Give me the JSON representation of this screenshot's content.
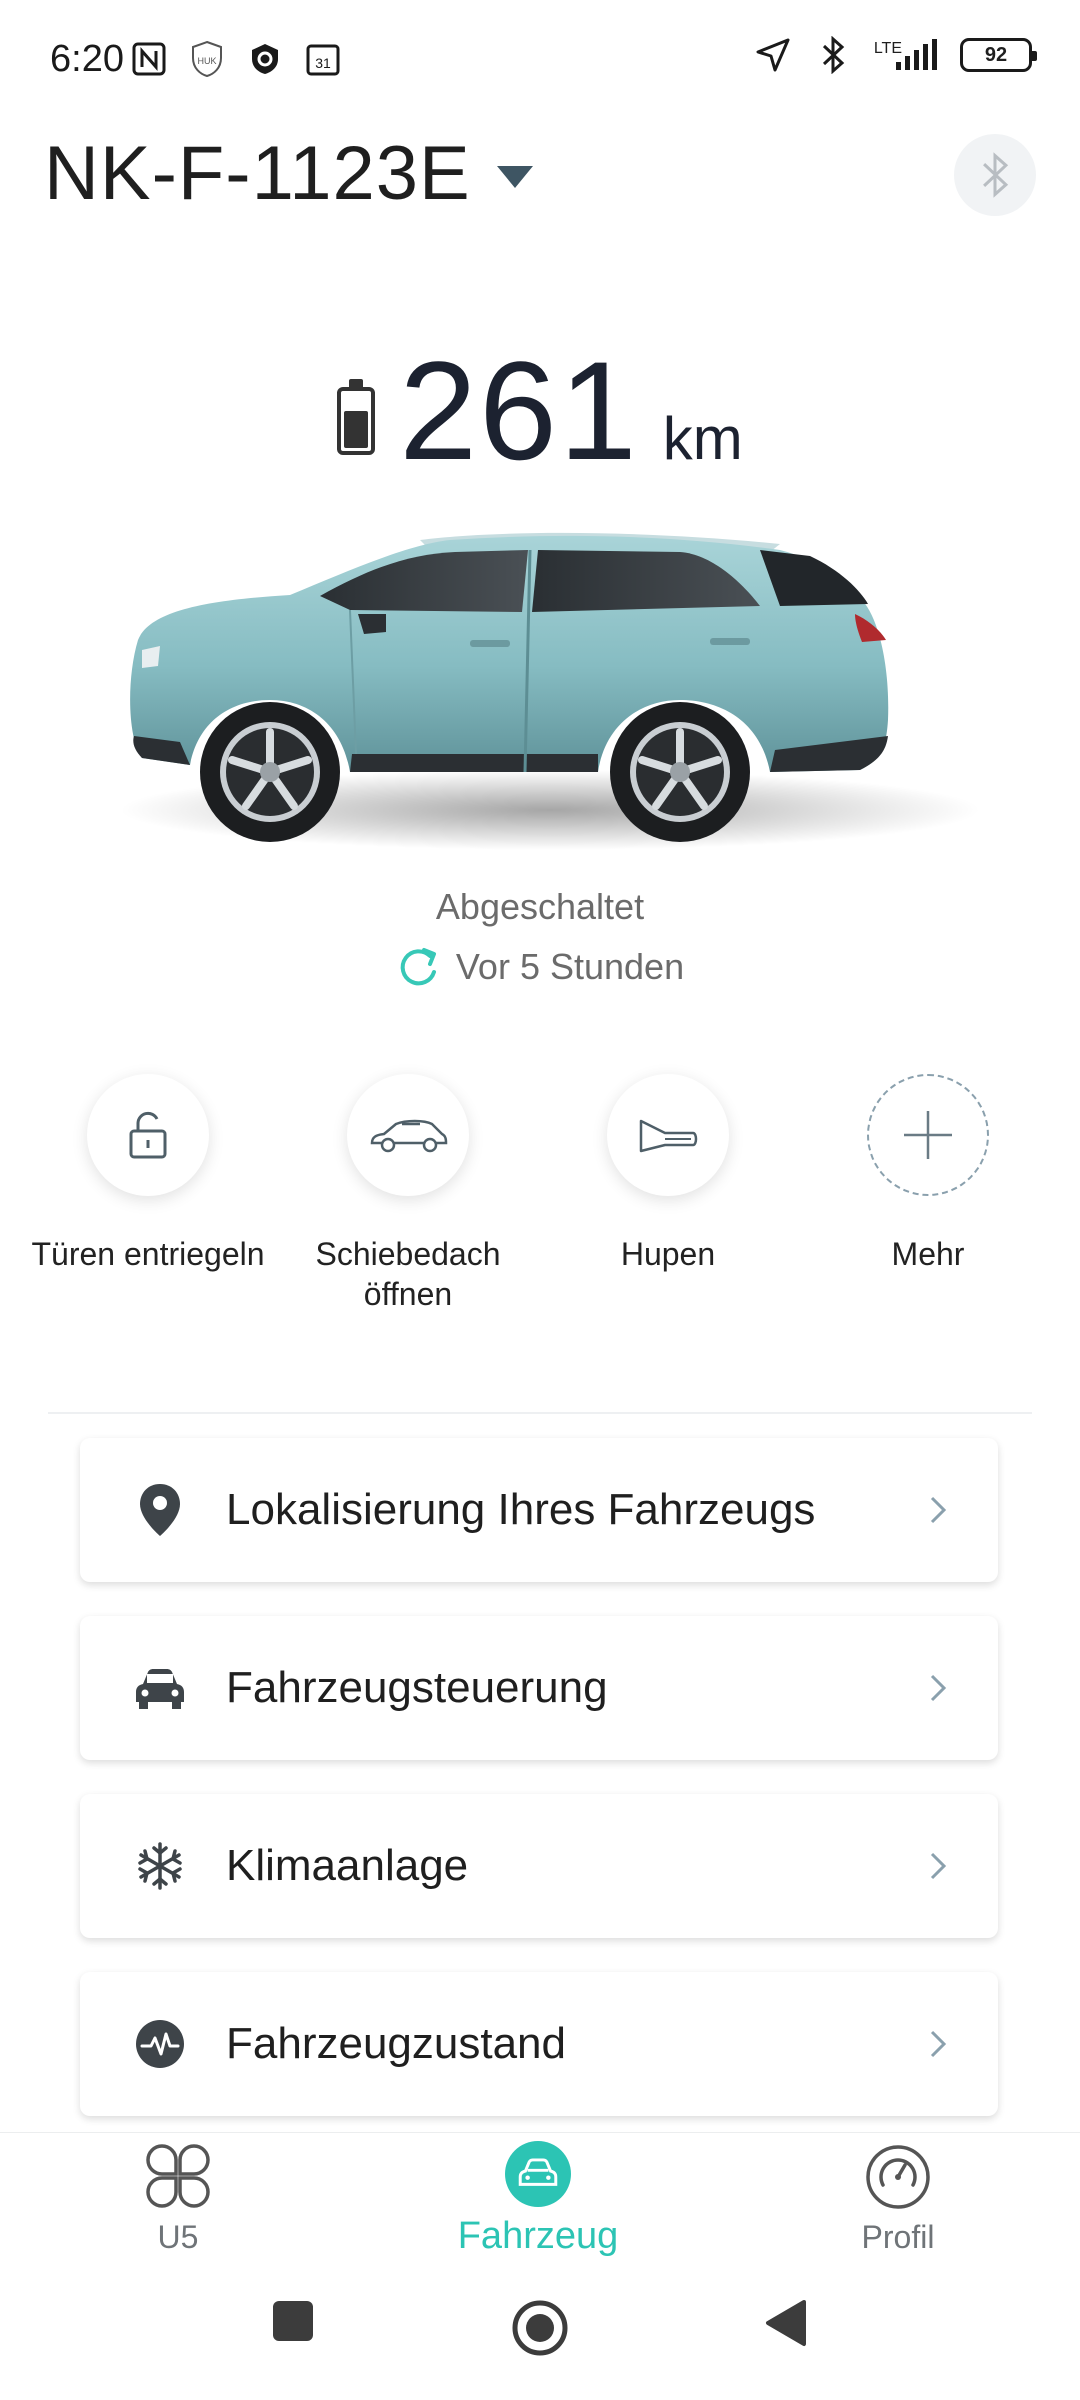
{
  "status_bar": {
    "time": "6:20",
    "left_icons": [
      "nfc-icon",
      "huk-shield-icon",
      "shield-app-icon",
      "calendar-31-icon"
    ],
    "right_icons": [
      "location-arrow-icon",
      "bluetooth-icon",
      "lte-signal-icon"
    ],
    "lte": "LTE",
    "battery": "92"
  },
  "header": {
    "plate": "NK-F-1123E"
  },
  "range": {
    "value": "261",
    "unit": "km",
    "battery_level": 0.62
  },
  "vehicle": {
    "status": "Abgeschaltet",
    "updated": "Vor 5 Stunden"
  },
  "quick_actions": [
    {
      "label": "Türen entriegeln",
      "icon": "unlock-icon"
    },
    {
      "label": "Schiebedach\nöffnen",
      "icon": "sunroof-car-icon"
    },
    {
      "label": "Hupen",
      "icon": "horn-icon"
    },
    {
      "label": "Mehr",
      "icon": "plus-icon"
    }
  ],
  "menu": [
    {
      "label": "Lokalisierung Ihres Fahrzeugs",
      "icon": "location-pin-icon"
    },
    {
      "label": "Fahrzeugsteuerung",
      "icon": "car-front-icon"
    },
    {
      "label": "Klimaanlage",
      "icon": "snowflake-icon"
    },
    {
      "label": "Fahrzeugzustand",
      "icon": "pulse-icon"
    }
  ],
  "bottom_nav": [
    {
      "label": "U5",
      "icon": "clover-icon"
    },
    {
      "label": "Fahrzeug",
      "icon": "car-icon",
      "active": true
    },
    {
      "label": "Profil",
      "icon": "profile-dial-icon"
    }
  ],
  "colors": {
    "accent": "#2cc4b4",
    "text": "#1f1f1f",
    "muted": "#6b6b6b"
  }
}
